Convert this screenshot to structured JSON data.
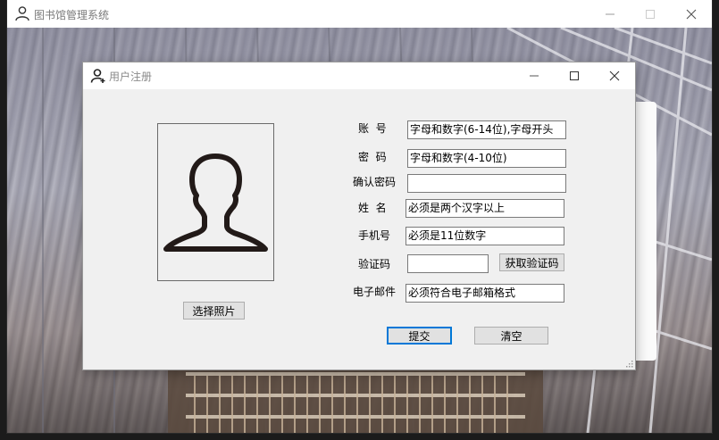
{
  "main_window": {
    "title": "图书馆管理系统",
    "icon": "user-icon"
  },
  "dialog": {
    "title": "用户注册",
    "icon": "user-add-icon",
    "photo_icon": "person-silhouette-icon",
    "select_photo_label": "选择照片",
    "fields": {
      "account": {
        "label": "账  号",
        "value": "字母和数字(6-14位),字母开头"
      },
      "password": {
        "label": "密  码",
        "value": "字母和数字(4-10位)"
      },
      "confirm_password": {
        "label": "确认密码",
        "value": ""
      },
      "name": {
        "label": "姓  名",
        "value": "必须是两个汉字以上"
      },
      "phone": {
        "label": "手机号",
        "value": "必须是11位数字"
      },
      "code": {
        "label": "验证码",
        "value": ""
      },
      "email": {
        "label": "电子邮件",
        "value": "必须符合电子邮箱格式"
      }
    },
    "get_code_label": "获取验证码",
    "submit_label": "提交",
    "clear_label": "清空"
  }
}
